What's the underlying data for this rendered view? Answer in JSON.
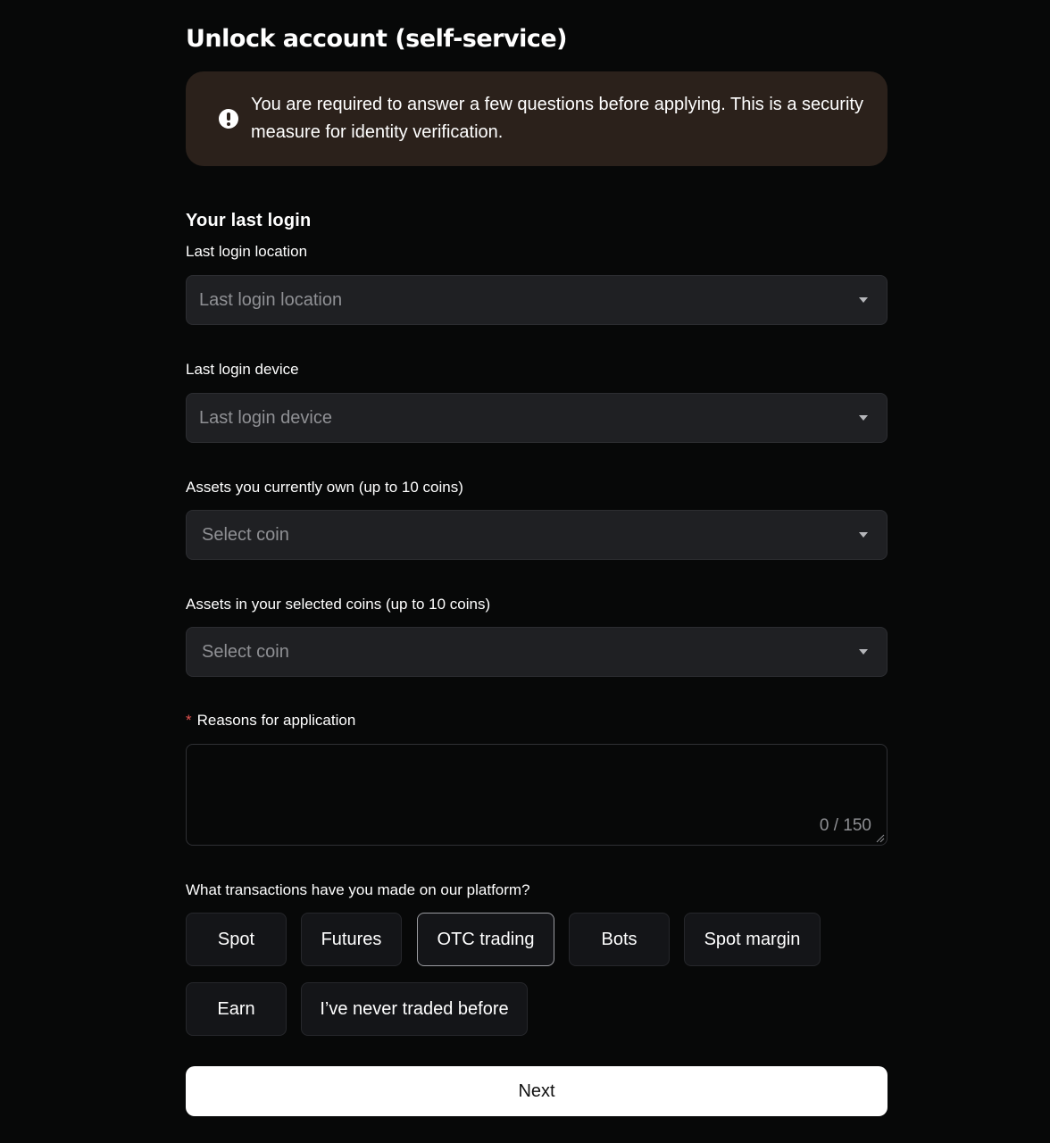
{
  "page": {
    "title": "Unlock account (self-service)"
  },
  "notice": {
    "icon": "exclamation-circle-icon",
    "text": "You are required to answer a few questions before applying. This is a security measure for identity verification."
  },
  "last_login": {
    "heading": "Your last login",
    "location": {
      "label": "Last login location",
      "placeholder": "Last login location"
    },
    "device": {
      "label": "Last login device",
      "placeholder": "Last login device"
    }
  },
  "assets_owned": {
    "label": "Assets you currently own (up to 10 coins)",
    "placeholder": "Select coin"
  },
  "assets_selected": {
    "label": "Assets in your selected coins (up to 10 coins)",
    "placeholder": "Select coin"
  },
  "reasons": {
    "required_mark": "*",
    "label": "Reasons for application",
    "counter": "0 / 150"
  },
  "transactions": {
    "question": "What transactions have you made on our platform?",
    "options": [
      {
        "label": "Spot",
        "selected": false
      },
      {
        "label": "Futures",
        "selected": false
      },
      {
        "label": "OTC trading",
        "selected": true
      },
      {
        "label": "Bots",
        "selected": false
      },
      {
        "label": "Spot margin",
        "selected": false
      },
      {
        "label": "Earn",
        "selected": false
      },
      {
        "label": "I’ve never traded before",
        "selected": false
      }
    ]
  },
  "actions": {
    "next_label": "Next"
  },
  "colors": {
    "background": "#070808",
    "notice_background": "#2b211b",
    "field_background": "#1f2023",
    "required": "#e0524f",
    "primary_button": "#ffffff"
  }
}
